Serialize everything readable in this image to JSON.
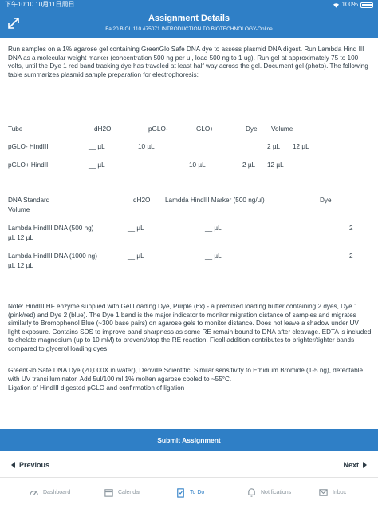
{
  "status_bar": {
    "time": "下午10:10  10月11日周日",
    "battery": "100%"
  },
  "header": {
    "title": "Assignment Details",
    "subtitle": "Fal20 BIOL 110 #75071 INTRODUCTION TO BIOTECHNOLOGY-Online"
  },
  "intro": "Run samples on a 1% agarose gel containing GreenGlo Safe DNA dye to assess plasmid DNA digest. Run Lambda Hind III DNA as a molecular weight marker (concentration 500 ng per ul, load 500 ng to 1 ug).  Run gel at approximately 75 to 100 volts, until the Dye 1 red band tracking dye has traveled at least half way across the gel.  Document gel (photo).  The following table summarizes plasmid sample preparation for electrophoresis:",
  "table1": {
    "headers": [
      "Tube",
      "dH2O",
      "pGLO-",
      "GLO+",
      "Dye",
      "Volume"
    ],
    "rows": [
      [
        "pGLO- HindIII",
        "__ µL",
        "10 µL",
        "",
        "2 µL",
        "12 µL"
      ],
      [
        "pGLO+ HindIII",
        "__ µL",
        "",
        "10 µL",
        "2 µL",
        "12 µL"
      ]
    ]
  },
  "table2": {
    "headers": [
      "DNA Standard",
      "dH2O",
      "Lamdda HindIII Marker (500 ng/ul)",
      "Dye"
    ],
    "header_wrap": "Volume",
    "rows": [
      {
        "name": "Lambda HindIII DNA  (500 ng)",
        "h2o": "__ µL",
        "marker": "__ µL",
        "dye": "2",
        "wrap": "µL    12 µL"
      },
      {
        "name": "Lambda HindIII DNA (1000 ng)",
        "h2o": "__ µL",
        "marker": "__ µL",
        "dye": "2",
        "wrap": "µL    12 µL"
      }
    ]
  },
  "note": "Note: HindIII HF enzyme supplied with Gel Loading Dye, Purple (6x) - a premixed loading buffer containing 2 dyes, Dye 1 (pink/red) and Dye 2 (blue). The Dye 1 band is the major indicator to monitor migration distance of samples and migrates similarly to Bromophenol Blue (~300 base pairs) on agarose gels to monitor distance. Does not leave a shadow under UV light exposure.  Contains SDS to improve band sharpness as some RE remain bound to DNA after cleavage.  EDTA is included to chelate magnesium (up to 10 mM) to prevent/stop the RE reaction.  Ficoll addition contributes to brighter/tighter bands compared to glycerol loading dyes.",
  "greenglo": "GreenGlo Safe DNA Dye (20,000X in water), Denville Scientific. Similar sensitivity to Ethidium Bromide (1-5 ng), detectable with UV transilluminator. Add 5ul/100 ml 1% molten agarose cooled to ~55°C.",
  "ligation": "Ligation of HindIII digested pGLO and confirmation of ligation",
  "submit_label": "Submit Assignment",
  "nav": {
    "previous": "Previous",
    "next": "Next"
  },
  "tabs": [
    {
      "label": "Dashboard",
      "icon": "dashboard-icon",
      "active": false
    },
    {
      "label": "Calendar",
      "icon": "calendar-icon",
      "active": false
    },
    {
      "label": "To Do",
      "icon": "todo-icon",
      "active": true
    },
    {
      "label": "Notifications",
      "icon": "bell-icon",
      "active": false
    },
    {
      "label": "Inbox",
      "icon": "inbox-icon",
      "active": false
    }
  ],
  "colors": {
    "accent": "#2f7fc6",
    "text": "#2d3b45",
    "tab_inactive": "#8b969e"
  }
}
